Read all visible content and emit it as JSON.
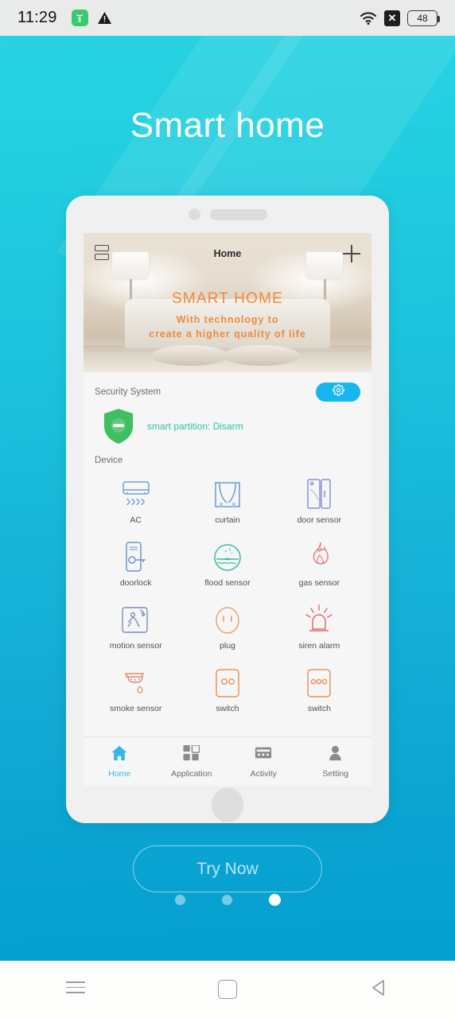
{
  "statusbar": {
    "time": "11:29",
    "icons_left": [
      "health-app-icon",
      "warning-triangle-icon"
    ],
    "icons_right": [
      "wifi-icon",
      "xbox-icon",
      "battery-icon"
    ],
    "battery_level": "48"
  },
  "page": {
    "title": "Smart home",
    "accent": "#1bbfdc",
    "background_top": "#27d3e2",
    "background_bottom": "#039fd0"
  },
  "app": {
    "header": {
      "title": "Home",
      "left_icon": "layout-list-icon",
      "right_icon": "plus-icon"
    },
    "hero": {
      "heading": "SMART HOME",
      "subheading": "With technology to\ncreate a higher quality of life",
      "sub_line_1": "With technology to",
      "sub_line_2": "create a higher quality of life",
      "text_color": "#ef8a3c"
    },
    "security": {
      "title": "Security System",
      "settings_icon": "gear-icon",
      "settings_color": "#18b5ee",
      "shield_icon": "shield-disarm-icon",
      "shield_color": "#3fbf62",
      "status": "smart partition: Disarm",
      "status_color": "#2ec4a6"
    },
    "devices": {
      "title": "Device",
      "items": [
        {
          "label": "AC",
          "icon": "ac-icon",
          "color": "#6f9fd8"
        },
        {
          "label": "curtain",
          "icon": "curtain-icon",
          "color": "#5f9fd6"
        },
        {
          "label": "door sensor",
          "icon": "door-sensor-icon",
          "color": "#8b8fd0"
        },
        {
          "label": "doorlock",
          "icon": "doorlock-icon",
          "color": "#6e93cf"
        },
        {
          "label": "flood sensor",
          "icon": "flood-sensor-icon",
          "color": "#3fb9a5"
        },
        {
          "label": "gas sensor",
          "icon": "gas-sensor-icon",
          "color": "#e8807f"
        },
        {
          "label": "motion sensor",
          "icon": "motion-sensor-icon",
          "color": "#7d8fb5"
        },
        {
          "label": "plug",
          "icon": "plug-icon",
          "color": "#e8a468"
        },
        {
          "label": "siren alarm",
          "icon": "siren-alarm-icon",
          "color": "#e06a6a"
        },
        {
          "label": "smoke sensor",
          "icon": "smoke-sensor-icon",
          "color": "#e08a6a"
        },
        {
          "label": "switch",
          "icon": "switch-2gang-icon",
          "color": "#e8935f"
        },
        {
          "label": "switch",
          "icon": "switch-3gang-icon",
          "color": "#e8935f"
        }
      ]
    },
    "tabs": [
      {
        "label": "Home",
        "icon": "home-icon",
        "active": true
      },
      {
        "label": "Application",
        "icon": "grid-icon",
        "active": false
      },
      {
        "label": "Activity",
        "icon": "activity-icon",
        "active": false
      },
      {
        "label": "Setting",
        "icon": "person-icon",
        "active": false
      }
    ]
  },
  "cta": {
    "label": "Try Now"
  },
  "pagination": {
    "count": 3,
    "active_index": 2
  },
  "android_nav": {
    "buttons": [
      "menu-icon",
      "home-square-icon",
      "back-triangle-icon"
    ]
  }
}
